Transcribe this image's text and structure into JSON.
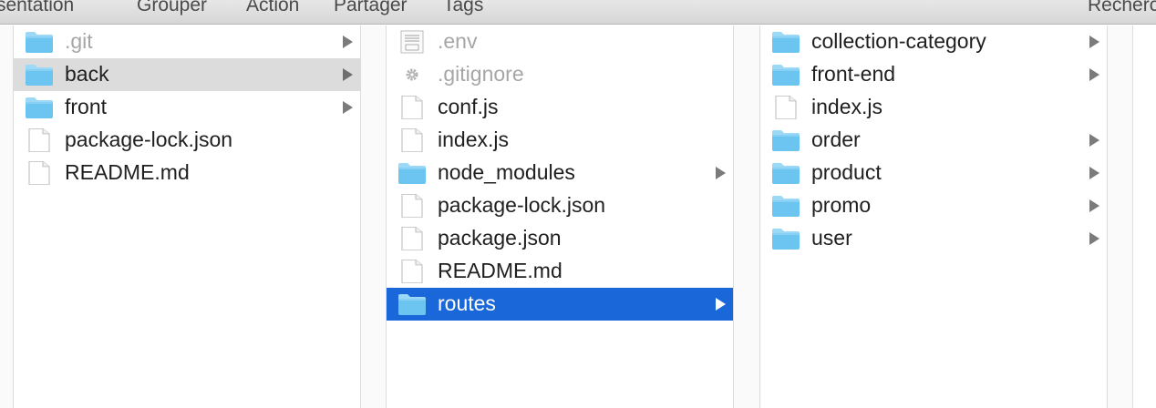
{
  "toolbar": {
    "items": [
      "sentation",
      "Grouper",
      "Action",
      "Partager",
      "Tags",
      "Recherc"
    ]
  },
  "columns": [
    {
      "items": [
        {
          "name": ".git",
          "kind": "folder",
          "dim": true,
          "arrow": true,
          "state": "none"
        },
        {
          "name": "back",
          "kind": "folder",
          "dim": false,
          "arrow": true,
          "state": "gray"
        },
        {
          "name": "front",
          "kind": "folder",
          "dim": false,
          "arrow": true,
          "state": "none"
        },
        {
          "name": "package-lock.json",
          "kind": "file",
          "dim": false,
          "arrow": false,
          "state": "none"
        },
        {
          "name": "README.md",
          "kind": "file",
          "dim": false,
          "arrow": false,
          "state": "none"
        }
      ]
    },
    {
      "items": [
        {
          "name": ".env",
          "kind": "text-file",
          "dim": true,
          "arrow": false,
          "state": "none"
        },
        {
          "name": ".gitignore",
          "kind": "gear",
          "dim": true,
          "arrow": false,
          "state": "none"
        },
        {
          "name": "conf.js",
          "kind": "file",
          "dim": false,
          "arrow": false,
          "state": "none"
        },
        {
          "name": "index.js",
          "kind": "file",
          "dim": false,
          "arrow": false,
          "state": "none"
        },
        {
          "name": "node_modules",
          "kind": "folder",
          "dim": false,
          "arrow": true,
          "state": "none"
        },
        {
          "name": "package-lock.json",
          "kind": "file",
          "dim": false,
          "arrow": false,
          "state": "none"
        },
        {
          "name": "package.json",
          "kind": "file",
          "dim": false,
          "arrow": false,
          "state": "none"
        },
        {
          "name": "README.md",
          "kind": "file",
          "dim": false,
          "arrow": false,
          "state": "none"
        },
        {
          "name": "routes",
          "kind": "folder",
          "dim": false,
          "arrow": true,
          "state": "blue"
        }
      ]
    },
    {
      "items": [
        {
          "name": "collection-category",
          "kind": "folder",
          "dim": false,
          "arrow": true,
          "state": "none"
        },
        {
          "name": "front-end",
          "kind": "folder",
          "dim": false,
          "arrow": true,
          "state": "none"
        },
        {
          "name": "index.js",
          "kind": "file",
          "dim": false,
          "arrow": false,
          "state": "none"
        },
        {
          "name": "order",
          "kind": "folder",
          "dim": false,
          "arrow": true,
          "state": "none"
        },
        {
          "name": "product",
          "kind": "folder",
          "dim": false,
          "arrow": true,
          "state": "none"
        },
        {
          "name": "promo",
          "kind": "folder",
          "dim": false,
          "arrow": true,
          "state": "none"
        },
        {
          "name": "user",
          "kind": "folder",
          "dim": false,
          "arrow": true,
          "state": "none"
        }
      ]
    }
  ],
  "colors": {
    "folder": "#6cc4f0",
    "folder_tab": "#9bd9f6",
    "selected_blue": "#1967d8",
    "selected_gray": "#dcdcdc"
  }
}
